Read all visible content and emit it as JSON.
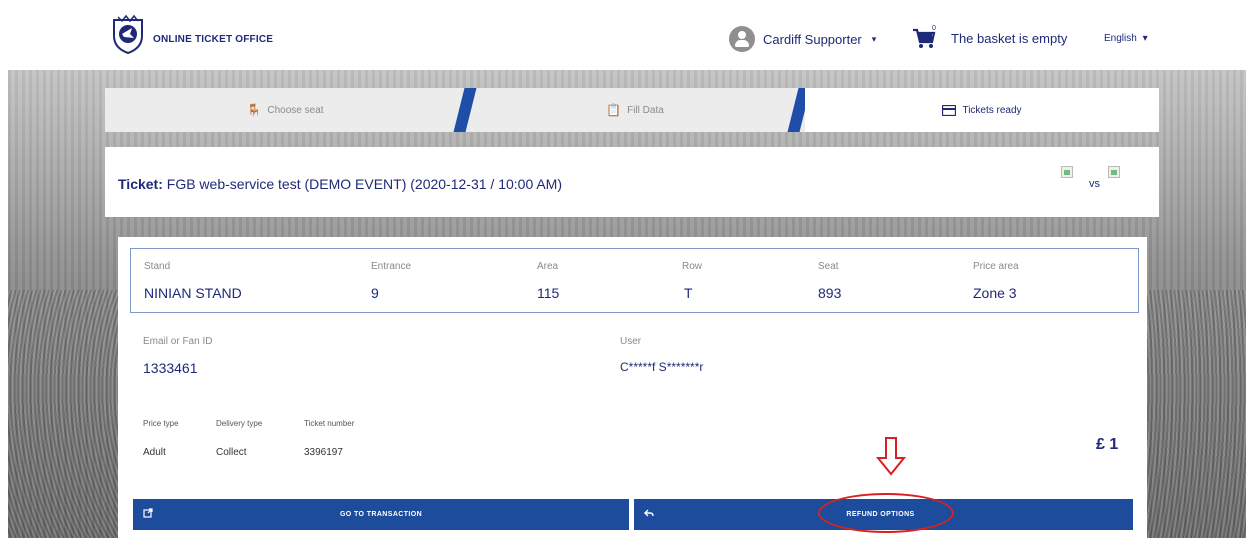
{
  "header": {
    "brand": "ONLINE TICKET OFFICE",
    "user": "Cardiff Supporter",
    "cart_count": "0",
    "basket": "The basket is empty",
    "language": "English",
    "caret": "▾"
  },
  "steps": [
    {
      "label": "Choose seat",
      "icon": "chair-icon"
    },
    {
      "label": "Fill Data",
      "icon": "clipboard-icon"
    },
    {
      "label": "Tickets ready",
      "icon": "card-icon"
    }
  ],
  "ticket": {
    "prefix": "Ticket:",
    "title": "FGB web-service test (DEMO EVENT) (2020-12-31 / 10:00 AM)",
    "vs": "vs"
  },
  "seat": {
    "columns": [
      {
        "label": "Stand",
        "value": "NINIAN STAND"
      },
      {
        "label": "Entrance",
        "value": "9"
      },
      {
        "label": "Area",
        "value": "115"
      },
      {
        "label": "Row",
        "value": "T"
      },
      {
        "label": "Seat",
        "value": "893"
      },
      {
        "label": "Price area",
        "value": "Zone 3"
      }
    ]
  },
  "owner": {
    "email_label": "Email or Fan ID",
    "email_value": "1333461",
    "user_label": "User",
    "user_value": "C*****f S*******r"
  },
  "details": {
    "price_type_label": "Price type",
    "price_type_value": "Adult",
    "delivery_label": "Delivery type",
    "delivery_value": "Collect",
    "ticket_label": "Ticket number",
    "ticket_value": "3396197",
    "price": "£ 1"
  },
  "buttons": {
    "transaction": "GO TO TRANSACTION",
    "refund": "REFUND OPTIONS"
  },
  "colors": {
    "brand": "#1e2a78",
    "button": "#1d4c9c",
    "highlight": "#d82121"
  }
}
